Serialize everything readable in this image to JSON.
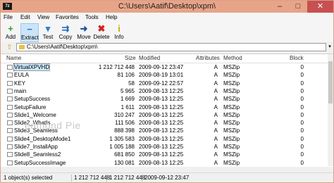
{
  "window": {
    "app_icon": "7z",
    "title": "C:\\Users\\Aatif\\Desktop\\xpm\\",
    "minimize_icon": "–",
    "maximize_icon": "□",
    "close_icon": "✕"
  },
  "menu": [
    "File",
    "Edit",
    "View",
    "Favorites",
    "Tools",
    "Help"
  ],
  "toolbar": [
    {
      "label": "Add",
      "icon": "+",
      "color": "#2e9e2e"
    },
    {
      "label": "Extract",
      "icon": "−",
      "color": "#2a6ad8"
    },
    {
      "label": "Test",
      "icon": "▾",
      "color": "#2a7fd0"
    },
    {
      "label": "Copy",
      "icon": "⇉",
      "color": "#1f6fbf"
    },
    {
      "label": "Move",
      "icon": "➜",
      "color": "#1f4f9f"
    },
    {
      "label": "Delete",
      "icon": "✖",
      "color": "#d02020"
    },
    {
      "label": "Info",
      "icon": "i",
      "color": "#d9a400"
    }
  ],
  "address": {
    "value": "C:\\Users\\Aatif\\Desktop\\xpm\\"
  },
  "columns": {
    "name": "Name",
    "size": "Size",
    "modified": "Modified",
    "attributes": "Attributes",
    "method": "Method",
    "block": "Block"
  },
  "rows": [
    {
      "name": "VirtualXPVHD",
      "size": "1 212 712 448",
      "modified": "2009-09-12 23:47",
      "attributes": "A",
      "method": "MSZip",
      "block": "0"
    },
    {
      "name": "EULA",
      "size": "81 106",
      "modified": "2009-08-19 13:01",
      "attributes": "A",
      "method": "MSZip",
      "block": "0"
    },
    {
      "name": "KEY",
      "size": "58",
      "modified": "2009-09-12 22:57",
      "attributes": "A",
      "method": "MSZip",
      "block": "0"
    },
    {
      "name": "main",
      "size": "5 965",
      "modified": "2009-08-13 12:25",
      "attributes": "A",
      "method": "MSZip",
      "block": "0"
    },
    {
      "name": "SetupSuccess",
      "size": "1 669",
      "modified": "2009-08-13 12:25",
      "attributes": "A",
      "method": "MSZip",
      "block": "0"
    },
    {
      "name": "SetupFailure",
      "size": "1 611",
      "modified": "2009-08-13 12:25",
      "attributes": "A",
      "method": "MSZip",
      "block": "0"
    },
    {
      "name": "Slide1_Welcome",
      "size": "310 247",
      "modified": "2009-08-13 12:25",
      "attributes": "A",
      "method": "MSZip",
      "block": "0"
    },
    {
      "name": "Slide2_WhatIs",
      "size": "111 506",
      "modified": "2009-08-13 12:25",
      "attributes": "A",
      "method": "MSZip",
      "block": "0"
    },
    {
      "name": "Slide3_Seamless",
      "size": "888 398",
      "modified": "2009-08-13 12:25",
      "attributes": "A",
      "method": "MSZip",
      "block": "0"
    },
    {
      "name": "Slide4_DesktopMode1",
      "size": "1 305 583",
      "modified": "2009-08-13 12:25",
      "attributes": "A",
      "method": "MSZip",
      "block": "0"
    },
    {
      "name": "Slide7_InstallApp",
      "size": "1 005 188",
      "modified": "2009-08-13 12:25",
      "attributes": "A",
      "method": "MSZip",
      "block": "0"
    },
    {
      "name": "Slide8_Seamless2",
      "size": "681 850",
      "modified": "2009-08-13 12:25",
      "attributes": "A",
      "method": "MSZip",
      "block": "0"
    },
    {
      "name": "SetupSuccessImage",
      "size": "130 081",
      "modified": "2009-08-13 12:25",
      "attributes": "A",
      "method": "MSZip",
      "block": "0"
    }
  ],
  "watermark": "edmond Pie",
  "status": {
    "selection": "1 object(s) selected",
    "size": "1 212 712 448",
    "packed": "1 212 712 448",
    "date": "2009-09-12 23:47"
  }
}
